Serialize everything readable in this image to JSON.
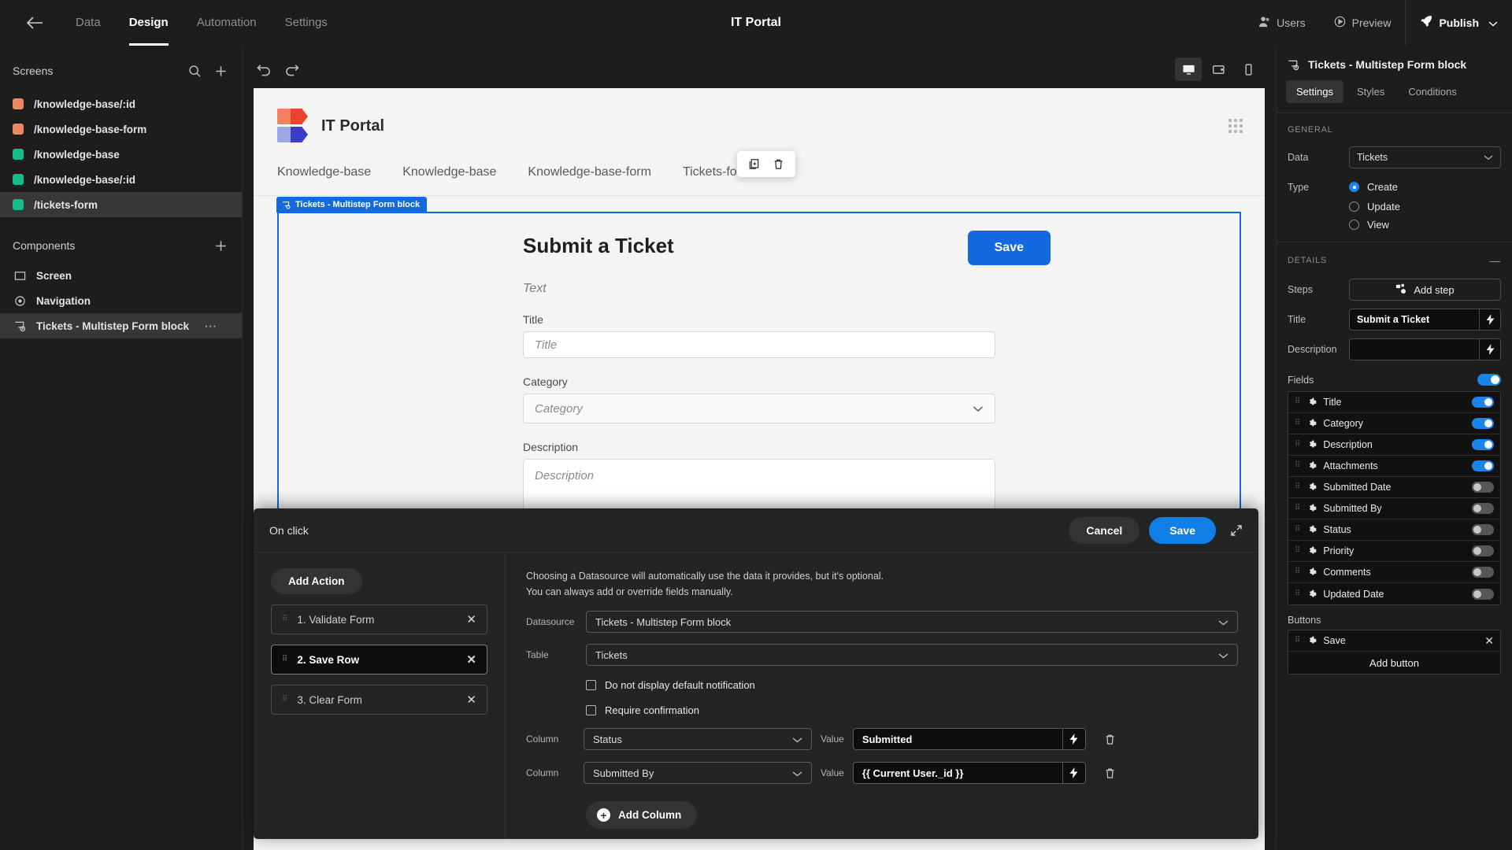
{
  "topbar": {
    "back_icon": "arrow-left-icon",
    "nav": [
      {
        "label": "Data",
        "active": false
      },
      {
        "label": "Design",
        "active": true
      },
      {
        "label": "Automation",
        "active": false
      },
      {
        "label": "Settings",
        "active": false
      }
    ],
    "app_title": "IT Portal",
    "users_label": "Users",
    "preview_label": "Preview",
    "publish_label": "Publish"
  },
  "sidebar": {
    "screens_title": "Screens",
    "components_title": "Components",
    "screens": [
      {
        "path": "/knowledge-base/:id",
        "color": "#f08763",
        "selected": false
      },
      {
        "path": "/knowledge-base-form",
        "color": "#f08763",
        "selected": false
      },
      {
        "path": "/knowledge-base",
        "color": "#19b98b",
        "selected": false
      },
      {
        "path": "/knowledge-base/:id",
        "color": "#19b98b",
        "selected": false
      },
      {
        "path": "/tickets-form",
        "color": "#19b98b",
        "selected": true
      }
    ],
    "components": [
      {
        "label": "Screen",
        "icon": "screen-icon",
        "selected": false,
        "menu": ""
      },
      {
        "label": "Navigation",
        "icon": "eye-icon",
        "selected": false,
        "menu": ""
      },
      {
        "label": "Tickets - Multistep Form block",
        "icon": "block-icon",
        "selected": true,
        "menu": "···"
      }
    ]
  },
  "canvas": {
    "toolbar": {
      "undo_icon": "undo-icon",
      "redo_icon": "redo-icon",
      "devices": [
        {
          "name": "desktop-icon",
          "active": true
        },
        {
          "name": "tablet-icon",
          "active": false
        },
        {
          "name": "mobile-icon",
          "active": false
        }
      ]
    },
    "preview": {
      "logo_text": "IT Portal",
      "nav_links": [
        "Knowledge-base",
        "Knowledge-base",
        "Knowledge-base-form",
        "Tickets-form"
      ],
      "float_toolbar": [
        "duplicate-icon",
        "delete-icon"
      ],
      "block_tag": "Tickets - Multistep Form block",
      "form_title": "Submit a Ticket",
      "save_label": "Save",
      "text_placeholder": "Text",
      "fields": [
        {
          "label": "Title",
          "placeholder": "Title",
          "type": "input"
        },
        {
          "label": "Category",
          "placeholder": "Category",
          "type": "select"
        },
        {
          "label": "Description",
          "placeholder": "Description",
          "type": "textarea"
        }
      ]
    }
  },
  "rightpanel": {
    "title": "Tickets - Multistep Form block",
    "tabs": [
      {
        "label": "Settings",
        "active": true
      },
      {
        "label": "Styles",
        "active": false
      },
      {
        "label": "Conditions",
        "active": false
      }
    ],
    "general_title": "GENERAL",
    "data_label": "Data",
    "data_value": "Tickets",
    "type_label": "Type",
    "type_options": [
      {
        "label": "Create",
        "selected": true
      },
      {
        "label": "Update",
        "selected": false
      },
      {
        "label": "View",
        "selected": false
      }
    ],
    "details_title": "DETAILS",
    "steps_label": "Steps",
    "add_step_label": "Add step",
    "title_label": "Title",
    "title_value": "Submit a Ticket",
    "description_label": "Description",
    "description_value": "",
    "fields_label": "Fields",
    "fields_master_on": true,
    "fields": [
      {
        "label": "Title",
        "on": true
      },
      {
        "label": "Category",
        "on": true
      },
      {
        "label": "Description",
        "on": true
      },
      {
        "label": "Attachments",
        "on": true
      },
      {
        "label": "Submitted Date",
        "on": false
      },
      {
        "label": "Submitted By",
        "on": false
      },
      {
        "label": "Status",
        "on": false
      },
      {
        "label": "Priority",
        "on": false
      },
      {
        "label": "Comments",
        "on": false
      },
      {
        "label": "Updated Date",
        "on": false
      }
    ],
    "buttons_label": "Buttons",
    "buttons": [
      {
        "label": "Save"
      }
    ],
    "add_button_label": "Add button"
  },
  "bottom_panel": {
    "header_title": "On click",
    "cancel_label": "Cancel",
    "save_label": "Save",
    "expand_icon": "expand-icon",
    "add_action_label": "Add Action",
    "actions": [
      {
        "label": "1. Validate Form",
        "selected": false
      },
      {
        "label": "2. Save Row",
        "selected": true
      },
      {
        "label": "3. Clear Form",
        "selected": false
      }
    ],
    "hint_line1": "Choosing a Datasource will automatically use the data it provides, but it's optional.",
    "hint_line2": "You can always add or override fields manually.",
    "datasource_label": "Datasource",
    "datasource_value": "Tickets - Multistep Form block",
    "table_label": "Table",
    "table_value": "Tickets",
    "checkboxes": [
      {
        "label": "Do not display default notification",
        "checked": false
      },
      {
        "label": "Require confirmation",
        "checked": false
      }
    ],
    "column_label": "Column",
    "value_label": "Value",
    "columns": [
      {
        "column": "Status",
        "value": "Submitted"
      },
      {
        "column": "Submitted By",
        "value": "{{ Current User._id }}"
      }
    ],
    "add_column_label": "Add Column"
  }
}
